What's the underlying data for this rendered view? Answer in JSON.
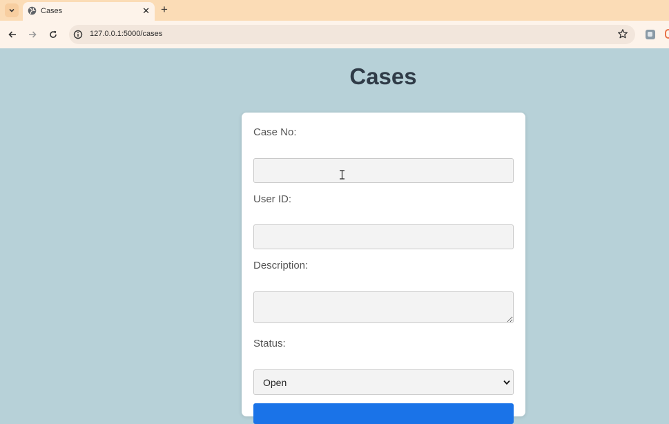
{
  "browser": {
    "tab_title": "Cases",
    "url": "127.0.0.1:5000/cases"
  },
  "page": {
    "title": "Cases"
  },
  "form": {
    "case_no_label": "Case No:",
    "case_no_value": "",
    "user_id_label": "User ID:",
    "user_id_value": "",
    "description_label": "Description:",
    "description_value": "",
    "status_label": "Status:",
    "status_selected": "Open"
  },
  "colors": {
    "background": "#b7d1d8",
    "tabbar": "#fbdcb6",
    "submit_button": "#1a73e8"
  }
}
